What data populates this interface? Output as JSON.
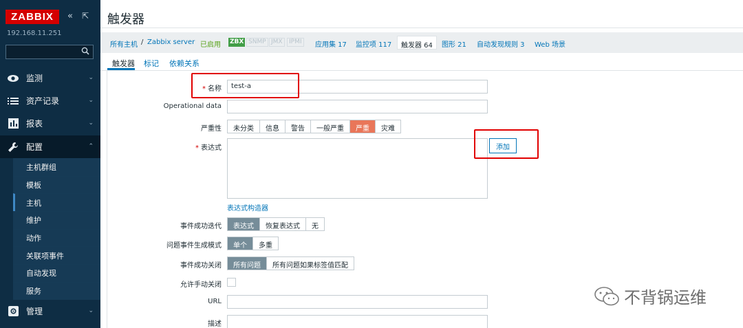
{
  "sidebar": {
    "logo": "ZABBIX",
    "collapse_icon": "«",
    "expand_icon": "⇱",
    "server_ip": "192.168.11.251",
    "search_placeholder": "",
    "menu": [
      {
        "label": "监测",
        "icon": "eye-icon",
        "chevron": "⌄"
      },
      {
        "label": "资产记录",
        "icon": "list-icon",
        "chevron": "⌄"
      },
      {
        "label": "报表",
        "icon": "chart-icon",
        "chevron": "⌄"
      },
      {
        "label": "配置",
        "icon": "wrench-icon",
        "chevron": "⌃"
      },
      {
        "label": "管理",
        "icon": "gear-icon",
        "chevron": "⌄"
      }
    ],
    "submenu": [
      "主机群组",
      "模板",
      "主机",
      "维护",
      "动作",
      "关联项事件",
      "自动发现",
      "服务"
    ]
  },
  "header": {
    "title": "触发器"
  },
  "hostnav": {
    "all_hosts": "所有主机",
    "separator": "/",
    "host": "Zabbix server",
    "enabled": "已启用",
    "tags": [
      "ZBX",
      "SNMP",
      "JMX",
      "IPMI"
    ],
    "apps": "应用集 17",
    "items": "监控项 117",
    "triggers": "触发器 64",
    "graphs": "图形 21",
    "discovery": "自动发现规则 3",
    "web": "Web 场景"
  },
  "tabs": [
    "触发器",
    "标记",
    "依赖关系"
  ],
  "form": {
    "name_label": "名称",
    "name_value": "test-a",
    "opdata_label": "Operational data",
    "opdata_value": "",
    "severity_label": "严重性",
    "severity_options": [
      "未分类",
      "信息",
      "警告",
      "一般严重",
      "严重",
      "灾难"
    ],
    "expression_label": "表达式",
    "add_button": "添加",
    "expression_builder": "表达式构造器",
    "ok_event_label": "事件成功迭代",
    "ok_event_options": [
      "表达式",
      "恢复表达式",
      "无"
    ],
    "problem_mode_label": "问题事件生成模式",
    "problem_mode_options": [
      "单个",
      "多重"
    ],
    "ok_close_label": "事件成功关闭",
    "ok_close_options": [
      "所有问题",
      "所有问题如果标签值匹配"
    ],
    "manual_close_label": "允许手动关闭",
    "url_label": "URL",
    "desc_label": "描述"
  },
  "watermark": {
    "text": "不背锅运维",
    "icon": "wechat-icon"
  },
  "colors": {
    "sidebar_bg": "#0e2d44",
    "logo_red": "#d40000",
    "link_blue": "#0275b8",
    "severity_high": "#e97659",
    "selected_grey": "#768d99",
    "highlight_red": "#e10000"
  }
}
